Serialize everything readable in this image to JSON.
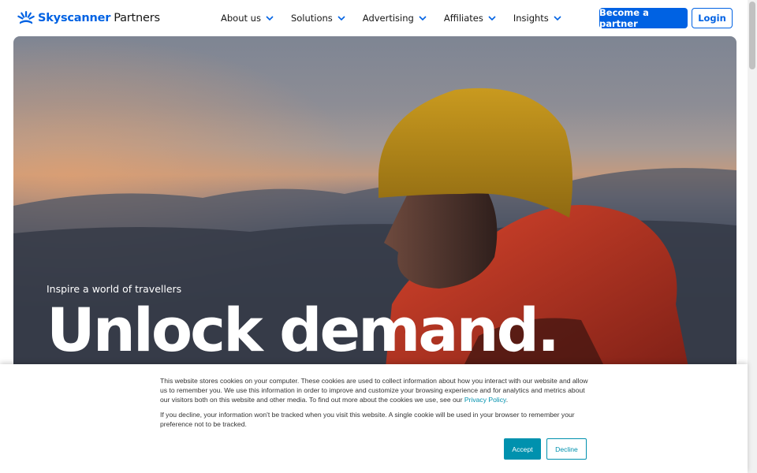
{
  "header": {
    "logo_brand": "Skyscanner",
    "logo_sub": "Partners",
    "nav": [
      {
        "label": "About us"
      },
      {
        "label": "Solutions"
      },
      {
        "label": "Advertising"
      },
      {
        "label": "Affiliates"
      },
      {
        "label": "Insights"
      }
    ],
    "primary_button": "Become a partner",
    "login_button": "Login"
  },
  "hero": {
    "kicker": "Inspire a world of travellers",
    "title": "Unlock demand."
  },
  "cookie_banner": {
    "paragraph1_text": "This website stores cookies on your computer. These cookies are used to collect information about how you interact with our website and allow us to remember you. We use this information in order to improve and customize your browsing experience and for analytics and metrics about our visitors both on this website and other media. To find out more about the cookies we use, see our ",
    "privacy_link": "Privacy Policy",
    "paragraph1_end": ".",
    "paragraph2": "If you decline, your information won't be tracked when you visit this website. A single cookie will be used in your browser to remember your preference not to be tracked.",
    "accept_label": "Accept",
    "decline_label": "Decline"
  },
  "colors": {
    "brand_blue": "#0062e3",
    "cookie_accent": "#0091ae",
    "text_dark": "#161616"
  }
}
